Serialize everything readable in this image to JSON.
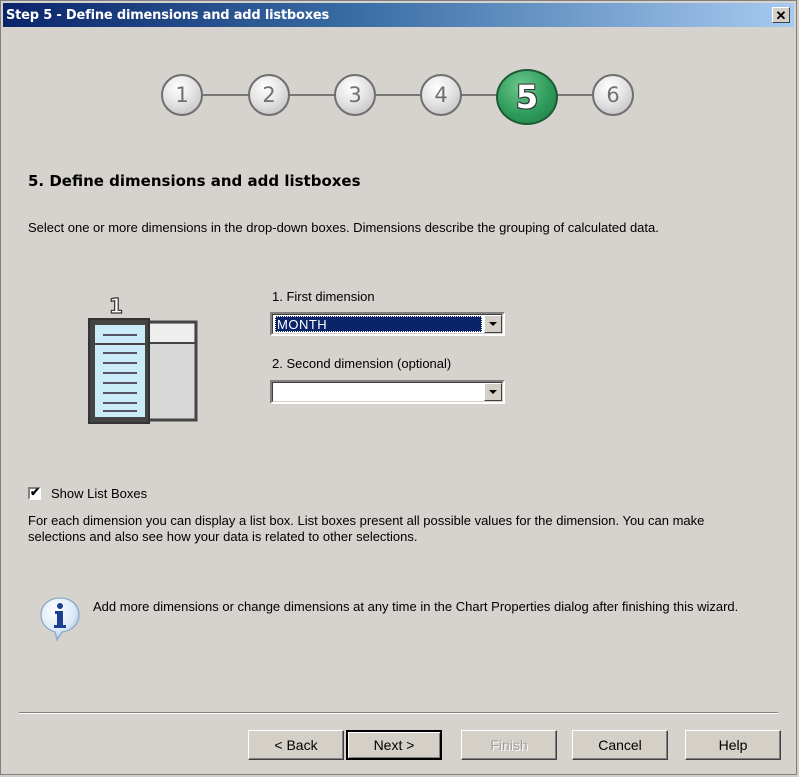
{
  "window": {
    "title": "Step 5 - Define dimensions and add listboxes",
    "close_icon": "close-x-icon"
  },
  "wizard_steps": {
    "current": 5,
    "items": [
      {
        "label": "1",
        "state": "inactive"
      },
      {
        "label": "2",
        "state": "inactive"
      },
      {
        "label": "3",
        "state": "inactive"
      },
      {
        "label": "4",
        "state": "inactive"
      },
      {
        "label": "5",
        "state": "active"
      },
      {
        "label": "6",
        "state": "inactive"
      }
    ],
    "active_color": "#2f9c5c"
  },
  "main": {
    "heading": "5. Define dimensions and add listboxes",
    "description": "Select one or more dimensions in the drop-down boxes. Dimensions describe the grouping of calculated data.",
    "illustration": {
      "icon": "listbox-dimension-icon",
      "badge": "1"
    },
    "first_dimension": {
      "label": "1. First dimension",
      "value": "MONTH"
    },
    "second_dimension": {
      "label": "2. Second dimension (optional)",
      "value": ""
    },
    "show_list_boxes": {
      "label": "Show List Boxes",
      "checked": true,
      "check_glyph": "✔"
    },
    "list_box_description": "For each dimension you can display a list box. List boxes present all possible values for the dimension. You can make selections and also see how your data is related to other selections.",
    "info": {
      "icon": "info-icon",
      "text": "Add more dimensions or change dimensions at any time in the Chart Properties dialog after finishing this wizard."
    }
  },
  "buttons": {
    "back": "< Back",
    "next": "Next >",
    "finish": "Finish",
    "cancel": "Cancel",
    "help": "Help"
  },
  "colors": {
    "titlebar_start": "#0a246a",
    "titlebar_end": "#a6caf0",
    "dialog_bg": "#d6d3ce",
    "selection_bg": "#0a246a"
  }
}
